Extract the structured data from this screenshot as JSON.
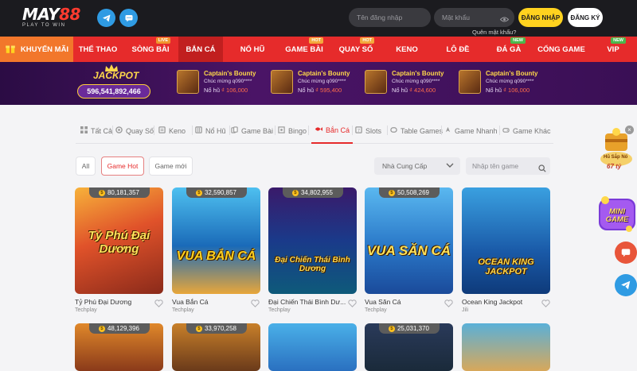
{
  "header": {
    "logo_main": "MAY88",
    "logo_sub": "PLAY TO WIN",
    "username_placeholder": "Tên đăng nhập",
    "password_placeholder": "Mật khẩu",
    "forgot_label": "Quên mật khẩu?",
    "login_label": "ĐĂNG NHẬP",
    "register_label": "ĐĂNG KÝ"
  },
  "nav": {
    "promo": "KHUYẾN MÃI",
    "items": [
      {
        "label": "THỂ THAO",
        "badge": ""
      },
      {
        "label": "SÒNG BÀI",
        "badge": "LIVE"
      },
      {
        "label": "BẮN CÁ",
        "badge": ""
      },
      {
        "label": "NỔ HŨ",
        "badge": ""
      },
      {
        "label": "GAME BÀI",
        "badge": "HOT"
      },
      {
        "label": "QUAY SỐ",
        "badge": "HOT"
      },
      {
        "label": "KENO",
        "badge": ""
      },
      {
        "label": "LÔ ĐỀ",
        "badge": ""
      },
      {
        "label": "ĐÁ GÀ",
        "badge": "NEW"
      },
      {
        "label": "CỔNG GAME",
        "badge": ""
      },
      {
        "label": "VIP",
        "badge": "NEW"
      }
    ]
  },
  "jackpot": {
    "title": "JACKPOT",
    "value": "596,541,892,466",
    "winners": [
      {
        "game": "Captain's Bounty",
        "line": "Chúc mừng q090****",
        "prefix": "Nổ hũ",
        "amount": "₫ 106,000"
      },
      {
        "game": "Captain's Bounty",
        "line": "Chúc mừng q090****",
        "prefix": "Nổ hũ",
        "amount": "₫ 595,400"
      },
      {
        "game": "Captain's Bounty",
        "line": "Chúc mừng q090****",
        "prefix": "Nổ hũ",
        "amount": "₫ 424,600"
      },
      {
        "game": "Captain's Bounty",
        "line": "Chúc mừng q090****",
        "prefix": "Nổ hũ",
        "amount": "₫ 106,000"
      }
    ]
  },
  "tabs": [
    "Tất Cả",
    "Quay Số",
    "Keno",
    "Nổ Hũ",
    "Game Bài",
    "Bingo",
    "Bắn Cá",
    "Slots",
    "Table Games",
    "Game Nhanh",
    "Game Khác"
  ],
  "filters": {
    "all": "All",
    "hot": "Game Hot",
    "new": "Game mới",
    "provider": "Nhà Cung Cấp",
    "search_placeholder": "Nhập tên game"
  },
  "games": [
    {
      "name": "Tỷ Phú Đại Dương",
      "provider": "Techplay",
      "jackpot": "80,181,357",
      "art": "Tỷ Phú Đại Dương"
    },
    {
      "name": "Vua Bắn Cá",
      "provider": "Techplay",
      "jackpot": "32,590,857",
      "art": "VUA BẮN CÁ"
    },
    {
      "name": "Đại Chiến Thái Bình Dư...",
      "provider": "Techplay",
      "jackpot": "34,802,955",
      "art": "Đại Chiến Thái Bình Dương"
    },
    {
      "name": "Vua Săn Cá",
      "provider": "Techplay",
      "jackpot": "50,508,269",
      "art": "VUA SĂN CÁ"
    },
    {
      "name": "Ocean King Jackpot",
      "provider": "Jili",
      "jackpot": "",
      "art": "OCEAN KING JACKPOT"
    }
  ],
  "games_row2": [
    "48,129,396",
    "33,970,258",
    "",
    "25,031,370",
    ""
  ],
  "sidebar": {
    "hu_label": "Hũ Sắp Nổ",
    "hu_value": "67 tỷ",
    "mini_label": "MINI GAME"
  }
}
